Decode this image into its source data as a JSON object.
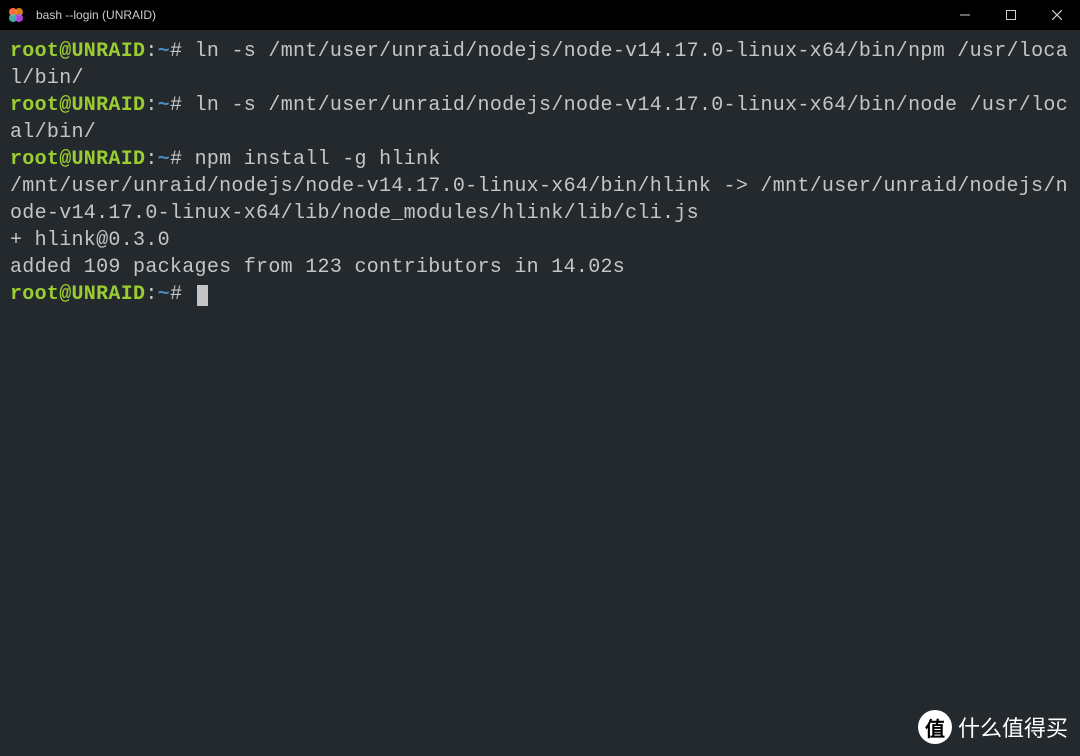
{
  "titlebar": {
    "title": "bash --login (UNRAID)"
  },
  "terminal": {
    "prompt": {
      "user": "root@UNRAID",
      "path": "~",
      "symbol": "#"
    },
    "lines": [
      {
        "type": "command",
        "cmd": "ln -s /mnt/user/unraid/nodejs/node-v14.17.0-linux-x64/bin/npm /usr/local/bin/"
      },
      {
        "type": "command",
        "cmd": "ln -s /mnt/user/unraid/nodejs/node-v14.17.0-linux-x64/bin/node /usr/local/bin/"
      },
      {
        "type": "command",
        "cmd": "npm install -g hlink"
      },
      {
        "type": "output",
        "text": "/mnt/user/unraid/nodejs/node-v14.17.0-linux-x64/bin/hlink -> /mnt/user/unraid/nodejs/node-v14.17.0-linux-x64/lib/node_modules/hlink/lib/cli.js"
      },
      {
        "type": "output",
        "text": "+ hlink@0.3.0"
      },
      {
        "type": "output",
        "text": "added 109 packages from 123 contributors in 14.02s"
      },
      {
        "type": "prompt-only"
      }
    ]
  },
  "watermark": {
    "badge": "值",
    "text": "什么值得买"
  }
}
